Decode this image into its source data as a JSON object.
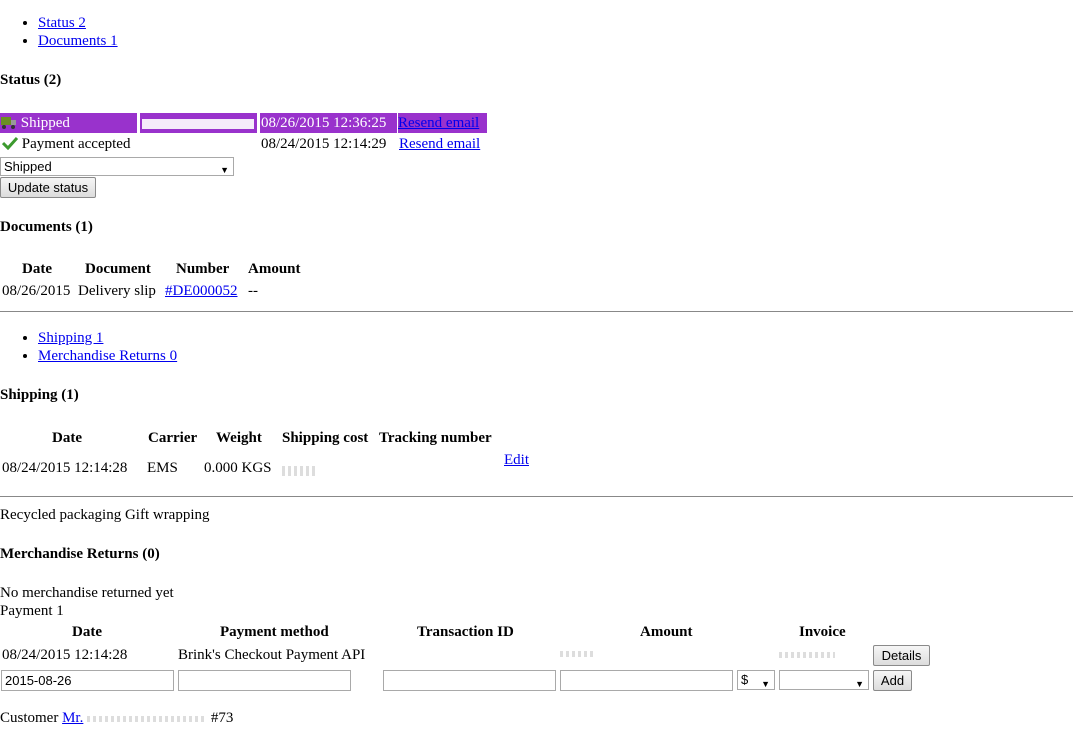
{
  "tabs_top": [
    {
      "label": "Status 2"
    },
    {
      "label": "Documents 1"
    }
  ],
  "status": {
    "heading": "Status (2)",
    "rows": [
      {
        "label": "Shipped",
        "date": "08/26/2015 12:36:25",
        "action": "Resend email"
      },
      {
        "label": "Payment accepted",
        "date": "08/24/2015 12:14:29",
        "action": "Resend email"
      }
    ],
    "select_value": "Shipped",
    "update_button": "Update status"
  },
  "documents": {
    "heading": "Documents (1)",
    "columns": [
      "Date",
      "Document",
      "Number",
      "Amount"
    ],
    "row": {
      "date": "08/26/2015",
      "document": "Delivery slip",
      "number": "#DE000052",
      "amount": "--"
    }
  },
  "tabs_mid": [
    {
      "label": "Shipping 1"
    },
    {
      "label": "Merchandise Returns 0"
    }
  ],
  "shipping": {
    "heading": "Shipping (1)",
    "columns": [
      "Date",
      "Carrier",
      "Weight",
      "Shipping cost",
      "Tracking number"
    ],
    "row": {
      "date": "08/24/2015 12:14:28",
      "carrier": "EMS",
      "weight": "0.000 KGS",
      "edit": "Edit"
    },
    "options_text": "Recycled packaging Gift wrapping"
  },
  "returns": {
    "heading": "Merchandise Returns (0)",
    "empty_text": "No merchandise returned yet"
  },
  "payment": {
    "label": "Payment 1",
    "columns": [
      "Date",
      "Payment method",
      "Transaction ID",
      "Amount",
      "Invoice"
    ],
    "row": {
      "date": "08/24/2015 12:14:28",
      "method": "Brink's Checkout Payment API",
      "details_button": "Details"
    },
    "form": {
      "date_value": "2015-08-26",
      "currency_value": "$",
      "add_button": "Add"
    }
  },
  "customer": {
    "label": "Customer",
    "link_text": "Mr.",
    "suffix": "#73"
  },
  "colors": {
    "status_shipped_bg": "#9932cc",
    "link": "#0000ee"
  }
}
